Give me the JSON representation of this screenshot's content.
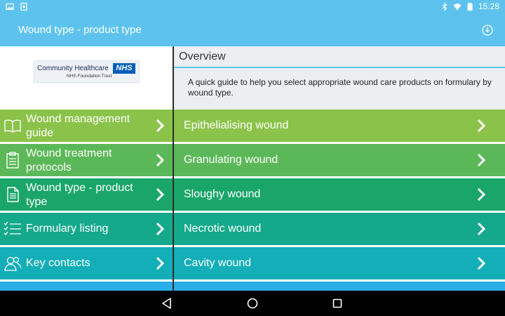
{
  "status_bar": {
    "time": "15:28",
    "icons": [
      "image-icon",
      "download-notification-icon",
      "bluetooth-icon",
      "wifi-icon",
      "battery-icon"
    ]
  },
  "app_bar": {
    "title": "Wound type - product type",
    "action_icon": "download-icon"
  },
  "logo": {
    "line1": "Community Healthcare",
    "nhs": "NHS",
    "line2": "NHS Foundation Trust"
  },
  "sidebar": {
    "items": [
      {
        "label": "Wound management guide",
        "icon": "book-icon",
        "color": "#8bc34a"
      },
      {
        "label": "Wound treatment protocols",
        "icon": "clipboard-icon",
        "color": "#5bb858"
      },
      {
        "label": "Wound type - product type",
        "icon": "document-icon",
        "color": "#1aa66a"
      },
      {
        "label": "Formulary listing",
        "icon": "checklist-icon",
        "color": "#15a98b"
      },
      {
        "label": "Key contacts",
        "icon": "contacts-icon",
        "color": "#13aeb8"
      },
      {
        "label": "",
        "icon": "",
        "color": "#2aaee8"
      }
    ]
  },
  "overview": {
    "title": "Overview",
    "description": "A quick guide to help you select appropriate wound care products on formulary by wound type."
  },
  "wound_types": [
    {
      "label": "Epithelialising wound",
      "color": "#8bc34a"
    },
    {
      "label": "Granulating wound",
      "color": "#5bb858"
    },
    {
      "label": "Sloughy wound",
      "color": "#1aa66a"
    },
    {
      "label": "Necrotic wound",
      "color": "#15a98b"
    },
    {
      "label": "Cavity wound",
      "color": "#13aeb8"
    },
    {
      "label": "",
      "color": "#2aaee8"
    }
  ],
  "colors": {
    "accent": "#5dc3ee"
  }
}
